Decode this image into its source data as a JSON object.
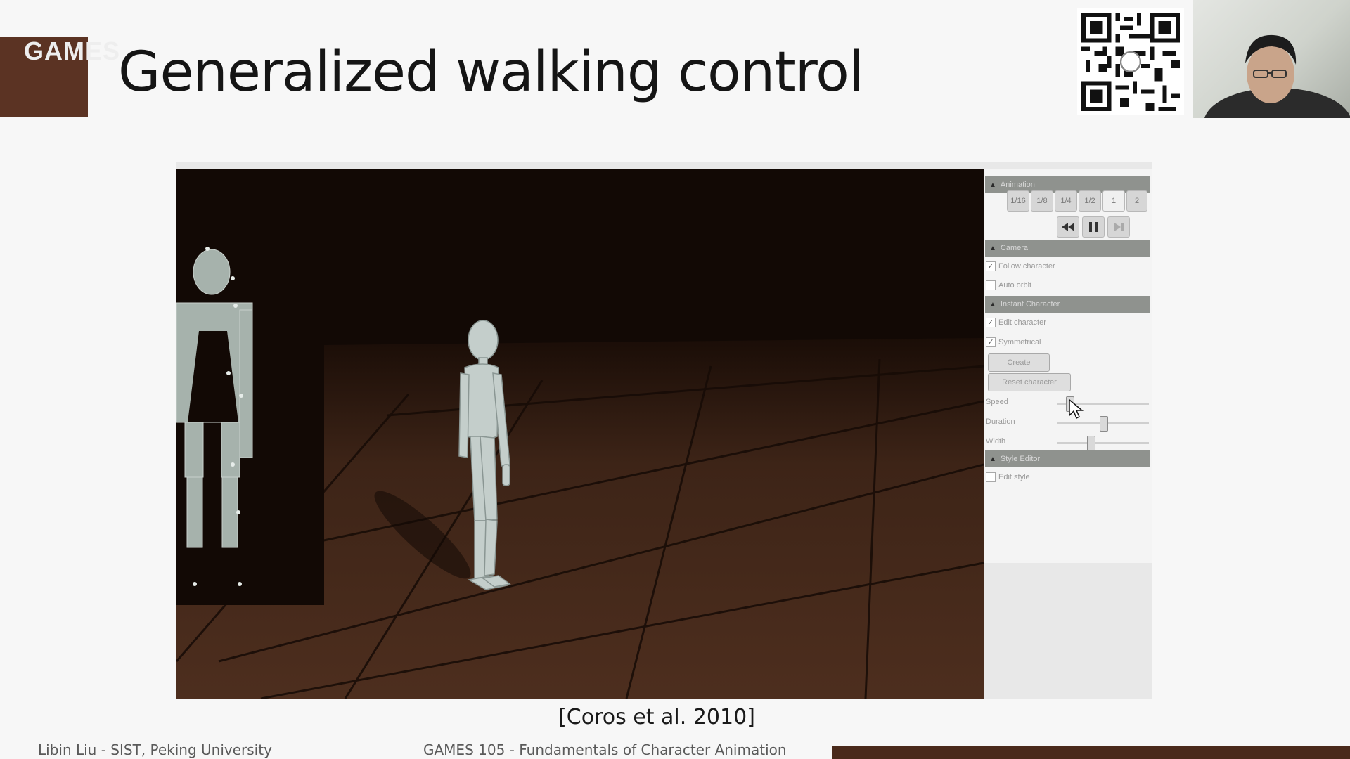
{
  "brand": {
    "text": "GAMES"
  },
  "slide": {
    "title": "Generalized walking control",
    "citation": "[Coros et al. 2010]"
  },
  "footer": {
    "left": "Libin Liu - SIST, Peking University",
    "center": "GAMES 105 - Fundamentals of Character Animation"
  },
  "panel": {
    "animation": {
      "header": "Animation",
      "speed_buttons": [
        "1/16",
        "1/8",
        "1/4",
        "1/2",
        "1",
        "2"
      ],
      "controls": [
        "rewind-icon",
        "pause-icon",
        "step-icon"
      ]
    },
    "camera": {
      "header": "Camera",
      "follow_character": {
        "label": "Follow character",
        "checked": true
      },
      "auto_orbit": {
        "label": "Auto orbit",
        "checked": false
      }
    },
    "instant_character": {
      "header": "Instant Character",
      "edit_character": {
        "label": "Edit character",
        "checked": true
      },
      "symmetrical": {
        "label": "Symmetrical",
        "checked": true
      },
      "create_label": "Create",
      "reset_label": "Reset character",
      "sliders": [
        {
          "label": "Speed",
          "value": 0.1
        },
        {
          "label": "Duration",
          "value": 0.5
        },
        {
          "label": "Width",
          "value": 0.35
        }
      ]
    },
    "style_editor": {
      "header": "Style Editor",
      "edit_style": {
        "label": "Edit style",
        "checked": false
      }
    }
  },
  "colors": {
    "brand": "#5b3323",
    "viewport_bg": "#120905",
    "floor": "#3a2216",
    "figure": "#a6b2ac"
  }
}
